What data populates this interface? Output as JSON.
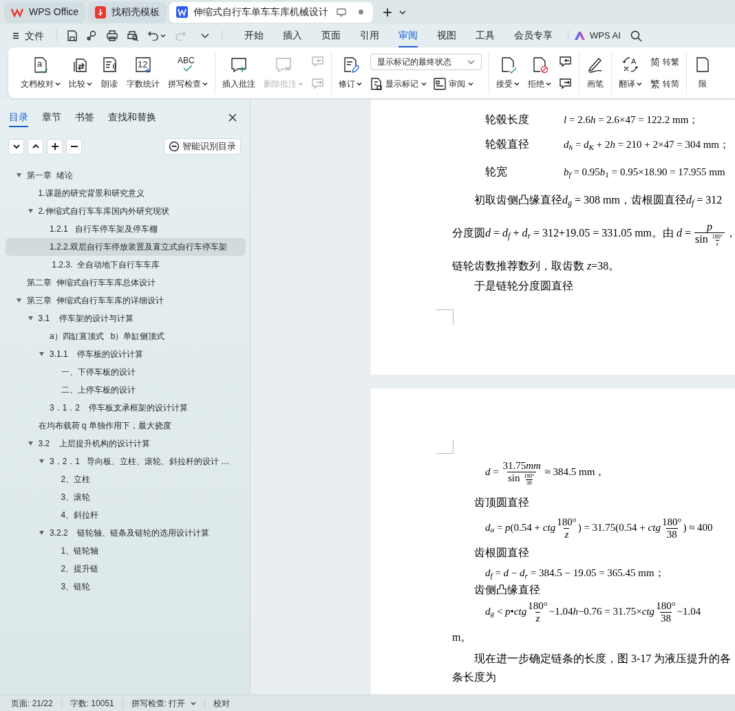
{
  "tabs": [
    {
      "kind": "wps",
      "label": "WPS Office",
      "selected": false
    },
    {
      "kind": "docer",
      "label": "找稻壳模板",
      "selected": false
    },
    {
      "kind": "writer",
      "label": "伸缩式自行车单车车库机械设计",
      "selected": true
    }
  ],
  "tab_add": "+",
  "menu": {
    "file": "文件",
    "tabs": [
      {
        "label": "开始",
        "selected": false
      },
      {
        "label": "插入",
        "selected": false
      },
      {
        "label": "页面",
        "selected": false
      },
      {
        "label": "引用",
        "selected": false
      },
      {
        "label": "审阅",
        "selected": true
      },
      {
        "label": "视图",
        "selected": false
      },
      {
        "label": "工具",
        "selected": false
      },
      {
        "label": "会员专享",
        "selected": false
      }
    ],
    "ai": "WPS AI"
  },
  "ribbon": [
    {
      "items": [
        {
          "kind": "big",
          "glyph": "a",
          "label": "文档校对",
          "dropdown": true,
          "disabled": false
        },
        {
          "kind": "big",
          "label": "比较",
          "dropdown": true,
          "disabled": false
        },
        {
          "kind": "big",
          "label": "朗读",
          "dropdown": false,
          "disabled": false
        },
        {
          "kind": "big",
          "glyph": "12",
          "label": "字数统计",
          "dropdown": false,
          "disabled": false
        },
        {
          "kind": "big",
          "glyph": "ABC",
          "label": "拼写检查",
          "dropdown": true,
          "disabled": false
        }
      ]
    },
    {
      "items": [
        {
          "kind": "big",
          "label": "插入批注",
          "dropdown": false,
          "disabled": false
        },
        {
          "kind": "big",
          "label": "删除批注",
          "dropdown": true,
          "disabled": true
        },
        {
          "kind": "stack",
          "items": [
            {
              "kind": "icon",
              "disabled": true
            },
            {
              "kind": "icon",
              "disabled": true
            }
          ]
        }
      ]
    },
    {
      "items": [
        {
          "kind": "big",
          "label": "修订",
          "dropdown": true,
          "disabled": false
        },
        {
          "kind": "stack",
          "items": [
            {
              "kind": "select",
              "value": "显示标记的最终状态"
            },
            {
              "kind": "row",
              "items": [
                {
                  "kind": "small",
                  "label": "显示标记",
                  "dropdown": true,
                  "disabled": false
                },
                {
                  "kind": "small",
                  "label": "审阅",
                  "dropdown": true,
                  "disabled": false
                }
              ]
            }
          ]
        }
      ]
    },
    {
      "items": [
        {
          "kind": "big",
          "label": "接受",
          "dropdown": true,
          "disabled": false
        },
        {
          "kind": "big",
          "label": "拒绝",
          "dropdown": true,
          "disabled": false
        },
        {
          "kind": "stack",
          "items": [
            {
              "kind": "icon",
              "disabled": false
            },
            {
              "kind": "icon",
              "disabled": false
            }
          ]
        }
      ]
    },
    {
      "items": [
        {
          "kind": "big",
          "label": "画笔",
          "dropdown": false,
          "disabled": false
        }
      ]
    },
    {
      "items": [
        {
          "kind": "big",
          "glyph": "A",
          "label": "翻译",
          "dropdown": true,
          "disabled": false
        },
        {
          "kind": "stack",
          "items": [
            {
              "kind": "small",
              "glyph": "简",
              "label": "转繁",
              "dropdown": false,
              "disabled": false
            },
            {
              "kind": "small",
              "glyph": "繁",
              "label": "转简",
              "dropdown": false,
              "disabled": false
            }
          ]
        }
      ]
    },
    {
      "items": [
        {
          "kind": "big",
          "label": "限",
          "dropdown": false,
          "disabled": false
        }
      ]
    }
  ],
  "sidebar": {
    "tabs": [
      {
        "label": "目录",
        "selected": true
      },
      {
        "label": "章节",
        "selected": false
      },
      {
        "label": "书签",
        "selected": false
      },
      {
        "label": "查找和替换",
        "selected": false
      }
    ],
    "smart_button": "智能识别目录",
    "toc": [
      {
        "label": "第一章  绪论",
        "selected": false,
        "expanded": true,
        "children": [
          {
            "label": "1.课题的研究背景和研究意义",
            "selected": false
          },
          {
            "label": "2.伸缩式自行车车库国内外研究现状",
            "selected": false,
            "expanded": true,
            "children": [
              {
                "label": "1.2.1   自行车停车架及停车棚",
                "selected": false
              },
              {
                "label": "1.2.2.双层自行车停放装置及直立式自行车停车架",
                "selected": true
              },
              {
                "label": " 1.2.3.  全自动地下自行车车库",
                "selected": false
              }
            ]
          }
        ]
      },
      {
        "label": "第二章  伸缩式自行车车库总体设计",
        "selected": false
      },
      {
        "label": "第三章  伸缩式自行车车库的详细设计",
        "selected": false,
        "expanded": true,
        "children": [
          {
            "label": "3.1    停车架的设计与计算",
            "selected": false,
            "expanded": true,
            "children": [
              {
                "label": "a）四缸直顶式   b）单缸侧顶式",
                "selected": false
              },
              {
                "label": "3.1.1    停车板的设计计算",
                "selected": false,
                "expanded": true,
                "children": [
                  {
                    "label": "一、下停车板的设计",
                    "selected": false
                  },
                  {
                    "label": "二、上停车板的设计",
                    "selected": false
                  }
                ]
              },
              {
                "label": "3．1．2    停车板支承框架的设计计算",
                "selected": false
              }
            ]
          },
          {
            "label": "在均布载荷 q 单独作用下，最大挠度",
            "selected": false
          },
          {
            "label": "3.2    上层提升机构的设计计算",
            "selected": false,
            "expanded": true,
            "children": [
              {
                "label": "3．2．1   导向板、立柱、滚轮、斜拉杆的设计 …",
                "selected": false,
                "expanded": true,
                "children": [
                  {
                    "label": "2、立柱",
                    "selected": false
                  },
                  {
                    "label": "3、滚轮",
                    "selected": false
                  },
                  {
                    "label": "4、斜拉杆",
                    "selected": false
                  }
                ]
              },
              {
                "label": "3.2.2    链轮轴、链条及链轮的选用设计计算",
                "selected": false,
                "expanded": true,
                "children": [
                  {
                    "label": "1、链轮轴",
                    "selected": false
                  },
                  {
                    "label": "2、提升链",
                    "selected": false
                  },
                  {
                    "label": "3、链轮",
                    "selected": false
                  }
                ]
              }
            ]
          }
        ]
      }
    ]
  },
  "pages": [
    {
      "lines": [
        {
          "kind": "labeled",
          "label": "轮毂长度",
          "segments": [
            {
              "kind": "var",
              "text": "l"
            },
            {
              "kind": "text",
              "text": " = 2.6"
            },
            {
              "kind": "var",
              "text": "h"
            },
            {
              "kind": "text",
              "text": " = 2.6×47 = 122.2 mm；"
            }
          ]
        },
        {
          "kind": "labeled",
          "label": "轮毂直径",
          "segments": [
            {
              "kind": "var",
              "text": "d"
            },
            {
              "kind": "sub",
              "text": "h"
            },
            {
              "kind": "text",
              "text": " = "
            },
            {
              "kind": "var",
              "text": "d"
            },
            {
              "kind": "sub",
              "text": "K"
            },
            {
              "kind": "text",
              "text": " + 2"
            },
            {
              "kind": "var",
              "text": "h"
            },
            {
              "kind": "text",
              "text": " = 210 + 2×47 = 304 mm；"
            }
          ]
        },
        {
          "kind": "labeled",
          "label": "轮宽",
          "segments": [
            {
              "kind": "var",
              "text": "b"
            },
            {
              "kind": "sub",
              "text": "f"
            },
            {
              "kind": "text",
              "text": " = 0.95"
            },
            {
              "kind": "var",
              "text": "b"
            },
            {
              "kind": "sub_upright",
              "text": "1"
            },
            {
              "kind": "text",
              "text": " = 0.95×18.90 = 17.955 mm"
            }
          ]
        },
        {
          "kind": "indent",
          "segments": [
            {
              "kind": "text",
              "text": "初取齿侧凸缘直径"
            },
            {
              "kind": "var",
              "text": "d"
            },
            {
              "kind": "sub",
              "text": "g"
            },
            {
              "kind": "text",
              "text": " = 308 mm，齿根圆直径"
            },
            {
              "kind": "var",
              "text": "d"
            },
            {
              "kind": "sub",
              "text": "f"
            },
            {
              "kind": "text",
              "text": " = 312"
            }
          ]
        },
        {
          "kind": "plain",
          "segments": [
            {
              "kind": "text",
              "text": "分度圆"
            },
            {
              "kind": "var",
              "text": "d"
            },
            {
              "kind": "text",
              "text": " = "
            },
            {
              "kind": "var",
              "text": "d"
            },
            {
              "kind": "sub",
              "text": "f"
            },
            {
              "kind": "text",
              "text": " + "
            },
            {
              "kind": "var",
              "text": "d"
            },
            {
              "kind": "sub",
              "text": "r"
            },
            {
              "kind": "text",
              "text": " = 312+19.05 = 331.05 mm。由 "
            },
            {
              "kind": "var",
              "text": "d"
            },
            {
              "kind": "text",
              "text": " = "
            },
            {
              "kind": "frac",
              "num": [
                {
                  "kind": "var",
                  "text": "p"
                }
              ],
              "den": [
                {
                  "kind": "text",
                  "text": "sin "
                },
                {
                  "kind": "frac",
                  "num": [
                    {
                      "kind": "text",
                      "text": "180°"
                    }
                  ],
                  "den": [
                    {
                      "kind": "var",
                      "text": "z"
                    }
                  ]
                }
              ]
            },
            {
              "kind": "text",
              "text": "，"
            }
          ]
        },
        {
          "kind": "plain",
          "segments": [
            {
              "kind": "text",
              "text": "链轮齿数推荐数列，取齿数 "
            },
            {
              "kind": "var",
              "text": "z"
            },
            {
              "kind": "text",
              "text": "=38。"
            }
          ]
        },
        {
          "kind": "indent",
          "segments": [
            {
              "kind": "text",
              "text": "于是链轮分度圆直径"
            }
          ]
        }
      ]
    },
    {
      "lines": [
        {
          "kind": "formula",
          "segments": [
            {
              "kind": "var",
              "text": "d"
            },
            {
              "kind": "text",
              "text": " = "
            },
            {
              "kind": "frac",
              "num": [
                {
                  "kind": "text",
                  "text": "31.75"
                },
                {
                  "kind": "var",
                  "text": "mm"
                }
              ],
              "den": [
                {
                  "kind": "text",
                  "text": "sin "
                },
                {
                  "kind": "frac",
                  "num": [
                    {
                      "kind": "text",
                      "text": "180°"
                    }
                  ],
                  "den": [
                    {
                      "kind": "text",
                      "text": "38"
                    }
                  ]
                }
              ]
            },
            {
              "kind": "text",
              "text": " ≈ 384.5 mm，"
            }
          ]
        },
        {
          "kind": "indent",
          "segments": [
            {
              "kind": "text",
              "text": "齿顶圆直径"
            }
          ]
        },
        {
          "kind": "formula",
          "segments": [
            {
              "kind": "var",
              "text": "d"
            },
            {
              "kind": "sub",
              "text": "a"
            },
            {
              "kind": "text",
              "text": " = "
            },
            {
              "kind": "var",
              "text": "p"
            },
            {
              "kind": "text",
              "text": "(0.54 + "
            },
            {
              "kind": "var",
              "text": "ctg"
            },
            {
              "kind": "frac",
              "num": [
                {
                  "kind": "text",
                  "text": "180°"
                }
              ],
              "den": [
                {
                  "kind": "var",
                  "text": "z"
                }
              ]
            },
            {
              "kind": "text",
              "text": ") = 31.75(0.54 + "
            },
            {
              "kind": "var",
              "text": "ctg"
            },
            {
              "kind": "frac",
              "num": [
                {
                  "kind": "text",
                  "text": "180°"
                }
              ],
              "den": [
                {
                  "kind": "text",
                  "text": "38"
                }
              ]
            },
            {
              "kind": "text",
              "text": ") ≈ 400"
            }
          ]
        },
        {
          "kind": "indent",
          "segments": [
            {
              "kind": "text",
              "text": "齿根圆直径"
            }
          ]
        },
        {
          "kind": "formula",
          "segments": [
            {
              "kind": "var",
              "text": "d"
            },
            {
              "kind": "sub",
              "text": "f"
            },
            {
              "kind": "text",
              "text": " = "
            },
            {
              "kind": "var",
              "text": "d"
            },
            {
              "kind": "text",
              "text": " − "
            },
            {
              "kind": "var",
              "text": "d"
            },
            {
              "kind": "sub",
              "text": "r"
            },
            {
              "kind": "text",
              "text": " = 384.5 − 19.05 = 365.45 mm；"
            }
          ]
        },
        {
          "kind": "indent",
          "segments": [
            {
              "kind": "text",
              "text": "齿侧凸缘直径"
            }
          ]
        },
        {
          "kind": "formula",
          "segments": [
            {
              "kind": "var",
              "text": "d"
            },
            {
              "kind": "sub",
              "text": "g"
            },
            {
              "kind": "text",
              "text": " < "
            },
            {
              "kind": "var",
              "text": "p"
            },
            {
              "kind": "text",
              "text": "•"
            },
            {
              "kind": "var",
              "text": "ctg"
            },
            {
              "kind": "frac",
              "num": [
                {
                  "kind": "text",
                  "text": "180°"
                }
              ],
              "den": [
                {
                  "kind": "var",
                  "text": "z"
                }
              ]
            },
            {
              "kind": "text",
              "text": "−1.04"
            },
            {
              "kind": "var",
              "text": "h"
            },
            {
              "kind": "text",
              "text": "−0.76 = 31.75×"
            },
            {
              "kind": "var",
              "text": "ctg"
            },
            {
              "kind": "frac",
              "num": [
                {
                  "kind": "text",
                  "text": "180°"
                }
              ],
              "den": [
                {
                  "kind": "text",
                  "text": "38"
                }
              ]
            },
            {
              "kind": "text",
              "text": "−1.04"
            }
          ]
        },
        {
          "kind": "plain",
          "segments": [
            {
              "kind": "text",
              "text": "m。"
            }
          ]
        },
        {
          "kind": "indent",
          "segments": [
            {
              "kind": "text",
              "text": "现在进一步确定链条的长度，图 3-17 为液压提升的各"
            }
          ]
        },
        {
          "kind": "plain",
          "segments": [
            {
              "kind": "text",
              "text": "条长度为"
            }
          ]
        }
      ]
    }
  ],
  "status_bar": [
    {
      "kind": "text",
      "label": "页面: 21/22"
    },
    {
      "kind": "text",
      "label": "字数: 10051"
    },
    {
      "kind": "dropdown",
      "label": "拼写检查: 打开"
    },
    {
      "kind": "text",
      "label": "校对"
    }
  ]
}
